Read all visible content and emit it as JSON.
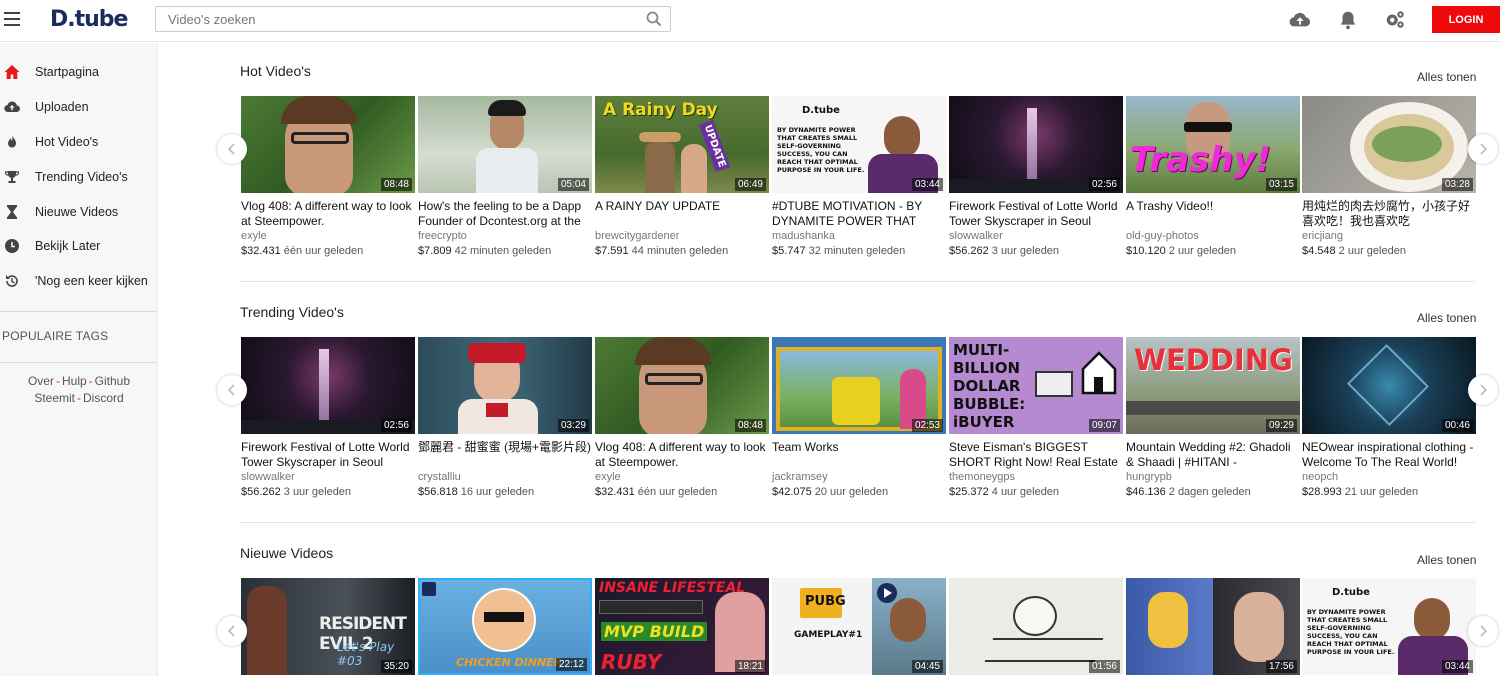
{
  "header": {
    "logo": "D.tube",
    "search_placeholder": "Video's zoeken",
    "login_label": "LOGIN"
  },
  "sidebar": {
    "items": [
      {
        "label": "Startpagina",
        "icon": "home-icon"
      },
      {
        "label": "Uploaden",
        "icon": "cloud-upload-icon"
      },
      {
        "label": "Hot Video's",
        "icon": "fire-icon"
      },
      {
        "label": "Trending Video's",
        "icon": "trophy-icon"
      },
      {
        "label": "Nieuwe Videos",
        "icon": "hourglass-icon"
      },
      {
        "label": "Bekijk Later",
        "icon": "clock-icon"
      },
      {
        "label": "'Nog een keer kijken",
        "icon": "history-icon"
      }
    ],
    "tags_heading": "POPULAIRE TAGS",
    "links": [
      "Over",
      "Hulp",
      "Github",
      "Steemit",
      "Discord"
    ]
  },
  "sections": [
    {
      "title": "Hot Video's",
      "show_all": "Alles tonen",
      "videos": [
        {
          "title": "Vlog 408: A different way to look at Steempower.",
          "author": "exyle",
          "value": "$32.431",
          "time": "één uur geleden",
          "duration": "08:48"
        },
        {
          "title": "How's the feeling to be a Dapp Founder of Dcontest.org at the",
          "author": "freecrypto",
          "value": "$7.809",
          "time": "42 minuten geleden",
          "duration": "05:04"
        },
        {
          "title": "A RAINY DAY UPDATE",
          "author": "brewcitygardener",
          "value": "$7.591",
          "time": "44 minuten geleden",
          "duration": "06:49"
        },
        {
          "title": "#DTUBE MOTIVATION - BY DYNAMITE POWER THAT",
          "author": "madushanka",
          "value": "$5.747",
          "time": "32 minuten geleden",
          "duration": "03:44"
        },
        {
          "title": "Firework Festival of Lotte World Tower Skyscraper in Seoul",
          "author": "slowwalker",
          "value": "$56.262",
          "time": "3 uur geleden",
          "duration": "02:56"
        },
        {
          "title": "A Trashy Video!!",
          "author": "old-guy-photos",
          "value": "$10.120",
          "time": "2 uur geleden",
          "duration": "03:15"
        },
        {
          "title": "用炖烂的肉去炒腐竹，小孩子好喜欢吃！我也喜欢吃",
          "author": "ericjiang",
          "value": "$4.548",
          "time": "2 uur geleden",
          "duration": "03:28"
        }
      ]
    },
    {
      "title": "Trending Video's",
      "show_all": "Alles tonen",
      "videos": [
        {
          "title": "Firework Festival of Lotte World Tower Skyscraper in Seoul",
          "author": "slowwalker",
          "value": "$56.262",
          "time": "3 uur geleden",
          "duration": "02:56"
        },
        {
          "title": "鄧麗君 - 甜蜜蜜 (現場+電影片段)",
          "author": "crystalliu",
          "value": "$56.818",
          "time": "16 uur geleden",
          "duration": "03:29"
        },
        {
          "title": "Vlog 408: A different way to look at Steempower.",
          "author": "exyle",
          "value": "$32.431",
          "time": "één uur geleden",
          "duration": "08:48"
        },
        {
          "title": "Team Works",
          "author": "jackramsey",
          "value": "$42.075",
          "time": "20 uur geleden",
          "duration": "02:53"
        },
        {
          "title": "Steve Eisman's BIGGEST SHORT Right Now! Real Estate Newest",
          "author": "themoneygps",
          "value": "$25.372",
          "time": "4 uur geleden",
          "duration": "09:07"
        },
        {
          "title": "Mountain Wedding #2: Ghadoli & Shaadi | #HITANI -",
          "author": "hungrypb",
          "value": "$46.136",
          "time": "2 dagen geleden",
          "duration": "09:29"
        },
        {
          "title": "NEOwear inspirational clothing - Welcome To The Real World!",
          "author": "neopch",
          "value": "$28.993",
          "time": "21 uur geleden",
          "duration": "00:46"
        }
      ]
    },
    {
      "title": "Nieuwe Videos",
      "show_all": "Alles tonen",
      "videos": [
        {
          "duration": "35:20"
        },
        {
          "duration": "22:12"
        },
        {
          "duration": "18:21"
        },
        {
          "duration": "04:45"
        },
        {
          "duration": "01:56"
        },
        {
          "duration": "17:56"
        },
        {
          "duration": "03:44"
        }
      ]
    }
  ],
  "thumb_text": {
    "rainy": "A Rainy Day",
    "update": "UPDATE",
    "dtube_small": "D.tube",
    "dynamite": "BY DYNAMITE POWER THAT CREATES SMALL SELF-GOVERNING SUCCESS, YOU CAN REACH THAT OPTIMAL PURPOSE IN YOUR LIFE.",
    "trashy": "Trashy!",
    "multi": "MULTI- BILLION DOLLAR BUBBLE: iBUYER",
    "wedding": "WEDDING",
    "resident": "RESIDENT EVIL 2",
    "letsplay": "Let's Play #03",
    "insane": "INSANE LIFESTEAL",
    "mvp": "MVP BUILD",
    "ruby": "RUBY",
    "pubg": "PUBG",
    "gameplay": "GAMEPLAY#1",
    "chicken": "CHICKEN DINNER"
  },
  "colors": {
    "accent": "#ee0a0a",
    "logo": "#1a2b5e"
  }
}
